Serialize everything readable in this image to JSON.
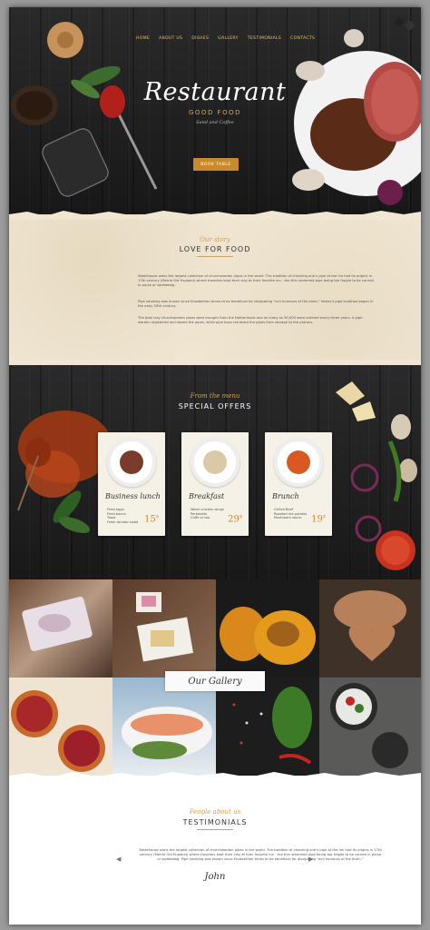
{
  "nav": [
    "HOME",
    "ABOUT US",
    "DISHES",
    "GALLERY",
    "TESTIMONIALS",
    "CONTACTS"
  ],
  "hero": {
    "title": "Restaurant",
    "subtitle": "GOOD FOOD",
    "tagline": "Sand and Coffee",
    "button": "BOOK TABLE"
  },
  "about": {
    "kicker": "Our story",
    "heading": "LOVE FOR FOOD",
    "paragraphs": [
      "Steakhouse owns the largest collection of churchwarden pipes in the world. The tradition of checking one’s pipe at the inn had its origins in 17th century (Merrie Old England) where travelers kept their clay at their favorite inn - the thin stemmed pipe being too fragile to be carried in purse or saddlebag.",
      "Pipe smoking was known since Elizabethan times to be beneficial for dissipating “evil humours of the brain.” Keens’s pipe tradition began in the early 20th century.",
      "The best clay churchwarden pipes were brought from the Netherlands and as many as 90,000 were ordered every three years. A pipe warden registered and stored the pipes, while pipe boys retrieved the pipes from storage to the patrons."
    ]
  },
  "offers": {
    "kicker": "From the menu",
    "heading": "SPECIAL OFFERS",
    "cards": [
      {
        "title": "Business lunch",
        "items": [
          "Fried eggs",
          "Fried bacon",
          "Toast",
          "Fresh tomato salad"
        ],
        "price": "15",
        "currency": "$",
        "food_color": "#7a3b2a"
      },
      {
        "title": "Breakfast",
        "items": [
          "Warm chicken wings",
          "Portobello",
          "Coffe or tea"
        ],
        "price": "29",
        "currency": "$",
        "food_color": "#d9c9a6"
      },
      {
        "title": "Brunch",
        "items": [
          "Grilled Beef",
          "Roasted red potatos",
          "Mushroom sauce"
        ],
        "price": "19",
        "currency": "$",
        "food_color": "#d85a22"
      }
    ]
  },
  "gallery": {
    "label": "Our Gallery"
  },
  "testimonials": {
    "kicker": "People about us",
    "heading": "TESTIMONIALS",
    "quote": "Steakhouse owns the largest collection of churchwarden pipes in the world. The tradition of checking one’s pipe at the inn had its origins in 17th century (Merrie Old England) where travelers kept their clay at their favorite inn - the thin stemmed pipe being too fragile to be carried in purse or saddlebag. Pipe smoking was known since Elizabethan times to be beneficial for dissipating “evil humours of the brain.”",
    "author": "John",
    "prev": "◀",
    "next": "▶"
  },
  "colors": {
    "accent": "#c98a2d",
    "paper": "#f0e6d2",
    "dark": "#1c1c1c"
  }
}
